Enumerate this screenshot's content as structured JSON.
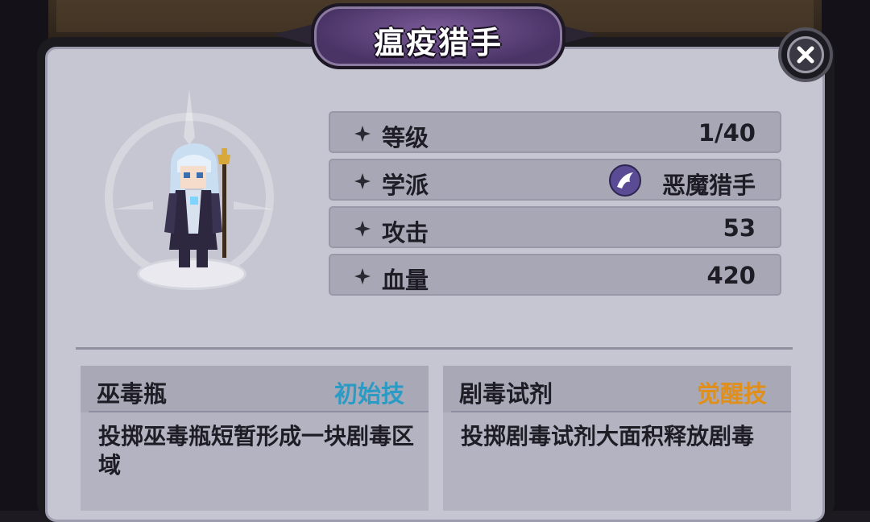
{
  "title": "瘟疫猎手",
  "stats": [
    {
      "label": "等级",
      "value": "1/40"
    },
    {
      "label": "学派",
      "value": "恶魔猎手",
      "icon": "demon-hunter-school-icon"
    },
    {
      "label": "攻击",
      "value": "53"
    },
    {
      "label": "血量",
      "value": "420"
    }
  ],
  "skills": [
    {
      "name": "巫毒瓶",
      "type": "初始技",
      "type_color": "#2a9bc4",
      "description": "投掷巫毒瓶短暂形成一块剧毒区域"
    },
    {
      "name": "剧毒试剂",
      "type": "觉醒技",
      "type_color": "#e08f1a",
      "description": "投掷剧毒试剂大面积释放剧毒"
    }
  ],
  "icons": {
    "close": "close-icon",
    "bullet": "four-point-star-icon",
    "character": "plague-hunter-character-sprite"
  }
}
